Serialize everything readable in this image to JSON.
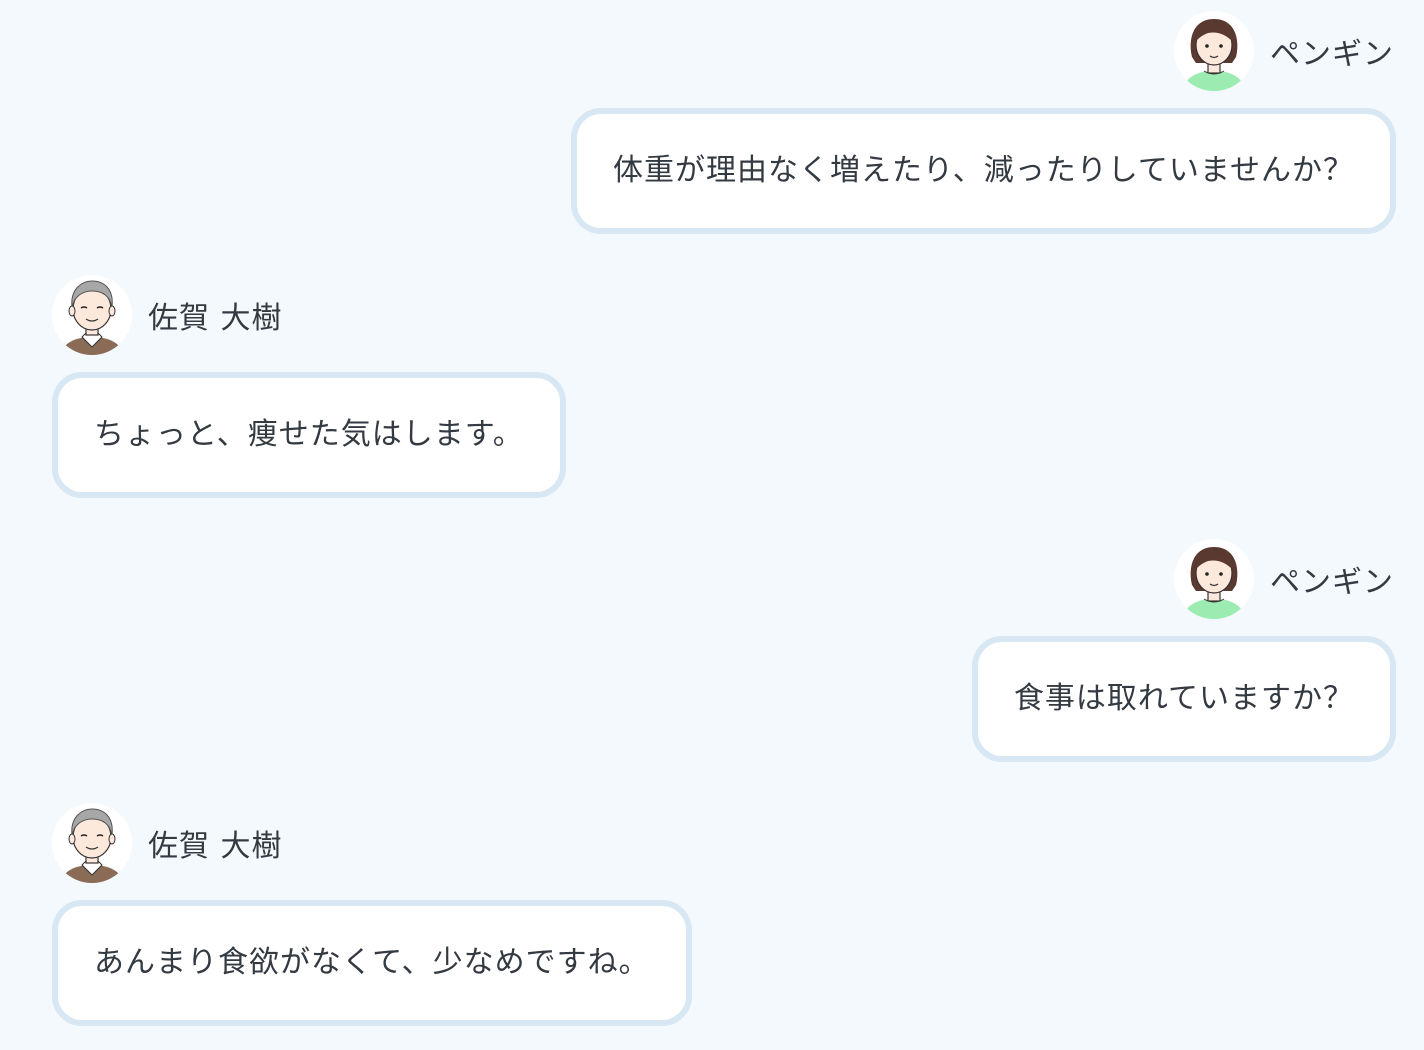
{
  "messages": [
    {
      "speaker": "ペンギン",
      "avatar": "woman-avatar-icon",
      "side": "right",
      "text": "体重が理由なく増えたり、減ったりしていませんか？"
    },
    {
      "speaker": "佐賀 大樹",
      "avatar": "elderly-man-avatar-icon",
      "side": "left",
      "text": "ちょっと、痩せた気はします。"
    },
    {
      "speaker": "ペンギン",
      "avatar": "woman-avatar-icon",
      "side": "right",
      "text": "食事は取れていますか？"
    },
    {
      "speaker": "佐賀 大樹",
      "avatar": "elderly-man-avatar-icon",
      "side": "left",
      "text": "あんまり食欲がなくて、少なめですね。"
    }
  ],
  "colors": {
    "background": "#f4f9fe",
    "bubble_border": "#d7e7f4",
    "bubble_fill": "#ffffff",
    "text": "#333a42"
  }
}
